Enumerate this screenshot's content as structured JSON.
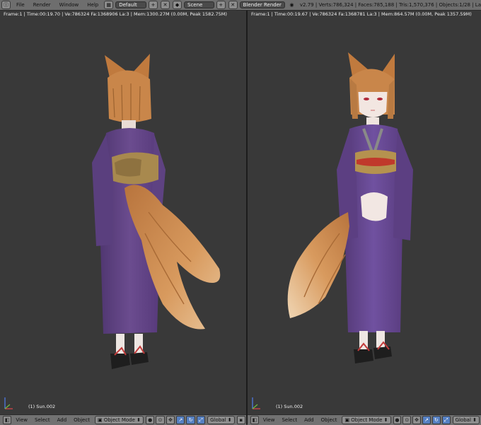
{
  "header": {
    "menus": [
      "File",
      "Render",
      "Window",
      "Help"
    ],
    "screen_layout": "Default",
    "scene": "Scene",
    "render_engine": "Blender Render",
    "stats": "v2.79 | Verts:786,324 | Faces:785,188 | Tris:1,570,376 | Objects:1/28 | La"
  },
  "viewports": [
    {
      "info": "Frame:1 | Time:00:19.70 | Ve:786324 Fa:1368906 La:3 | Mem:1300.27M (0.00M, Peak 1582.75M)",
      "object": "(1) Sun.002",
      "view": "back"
    },
    {
      "info": "Frame:1 | Time:00:19.67 | Ve:786324 Fa:1368781 La:3 | Mem:864.57M (0.00M, Peak 1357.59M)",
      "object": "(1) Sun.002",
      "view": "front"
    }
  ],
  "bottom_bar": {
    "menus": [
      "View",
      "Select",
      "Add",
      "Object"
    ],
    "mode": "Object Mode",
    "orientation": "Global"
  },
  "colors": {
    "kimono": "#6a4b8c",
    "fur": "#c98a4c",
    "obi": "#a8894e",
    "viewport_bg": "#393939"
  }
}
